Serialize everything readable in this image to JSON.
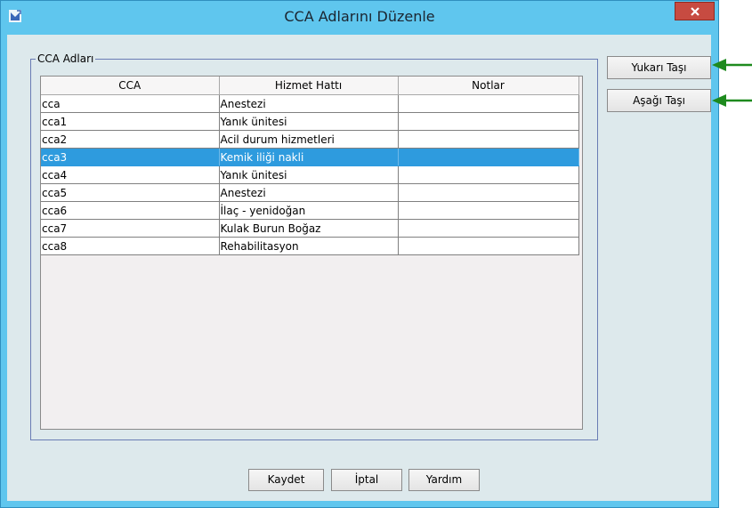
{
  "window": {
    "title": "CCA Adlarını Düzenle",
    "close_label": "x"
  },
  "group": {
    "legend": "CCA Adları"
  },
  "table": {
    "columns": [
      "CCA",
      "Hizmet Hattı",
      "Notlar"
    ],
    "rows": [
      {
        "cca": "cca",
        "service": "Anestezi",
        "notes": ""
      },
      {
        "cca": "cca1",
        "service": "Yanık ünitesi",
        "notes": ""
      },
      {
        "cca": "cca2",
        "service": "Acil durum hizmetleri",
        "notes": ""
      },
      {
        "cca": "cca3",
        "service": "Kemik iliği nakli",
        "notes": "",
        "selected": true
      },
      {
        "cca": "cca4",
        "service": "Yanık ünitesi",
        "notes": ""
      },
      {
        "cca": "cca5",
        "service": "Anestezi",
        "notes": ""
      },
      {
        "cca": "cca6",
        "service": "İlaç - yenidoğan",
        "notes": ""
      },
      {
        "cca": "cca7",
        "service": "Kulak Burun Boğaz",
        "notes": ""
      },
      {
        "cca": "cca8",
        "service": "Rehabilitasyon",
        "notes": ""
      }
    ]
  },
  "side_buttons": {
    "move_up": "Yukarı Taşı",
    "move_down": "Aşağı Taşı"
  },
  "bottom_buttons": {
    "save": "Kaydet",
    "cancel": "İptal",
    "help": "Yardım"
  },
  "colors": {
    "titlebar": "#5fc6ee",
    "selection": "#2e9bde",
    "close_button": "#c74b41",
    "callout_arrow": "#1e8a1e"
  }
}
